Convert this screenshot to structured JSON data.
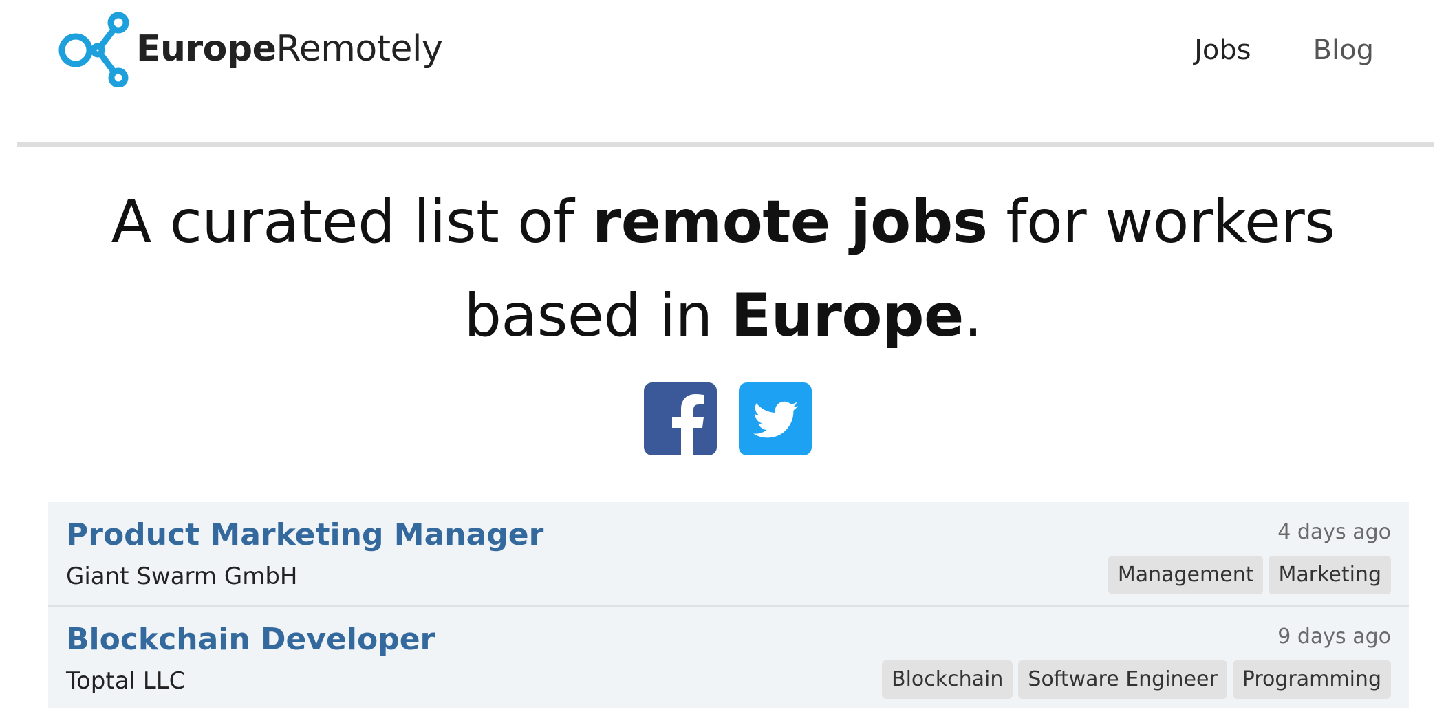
{
  "brand": {
    "name_bold": "Europe",
    "name_regular": "Remotely",
    "accent_color": "#1ea0dd"
  },
  "nav": {
    "jobs_label": "Jobs",
    "blog_label": "Blog"
  },
  "hero": {
    "line1_a": "A curated list of ",
    "line1_b": "remote jobs",
    "line1_c": " for workers",
    "line2_a": "based in ",
    "line2_b": "Europe",
    "line2_c": "."
  },
  "social": {
    "facebook": {
      "icon": "facebook-icon",
      "color": "#3b5998"
    },
    "twitter": {
      "icon": "twitter-icon",
      "color": "#1da1f2"
    }
  },
  "jobs": [
    {
      "title": "Product Marketing Manager",
      "company": "Giant Swarm GmbH",
      "age": "4 days ago",
      "tags": [
        "Management",
        "Marketing"
      ]
    },
    {
      "title": "Blockchain Developer",
      "company": "Toptal LLC",
      "age": "9 days ago",
      "tags": [
        "Blockchain",
        "Software Engineer",
        "Programming"
      ]
    }
  ]
}
